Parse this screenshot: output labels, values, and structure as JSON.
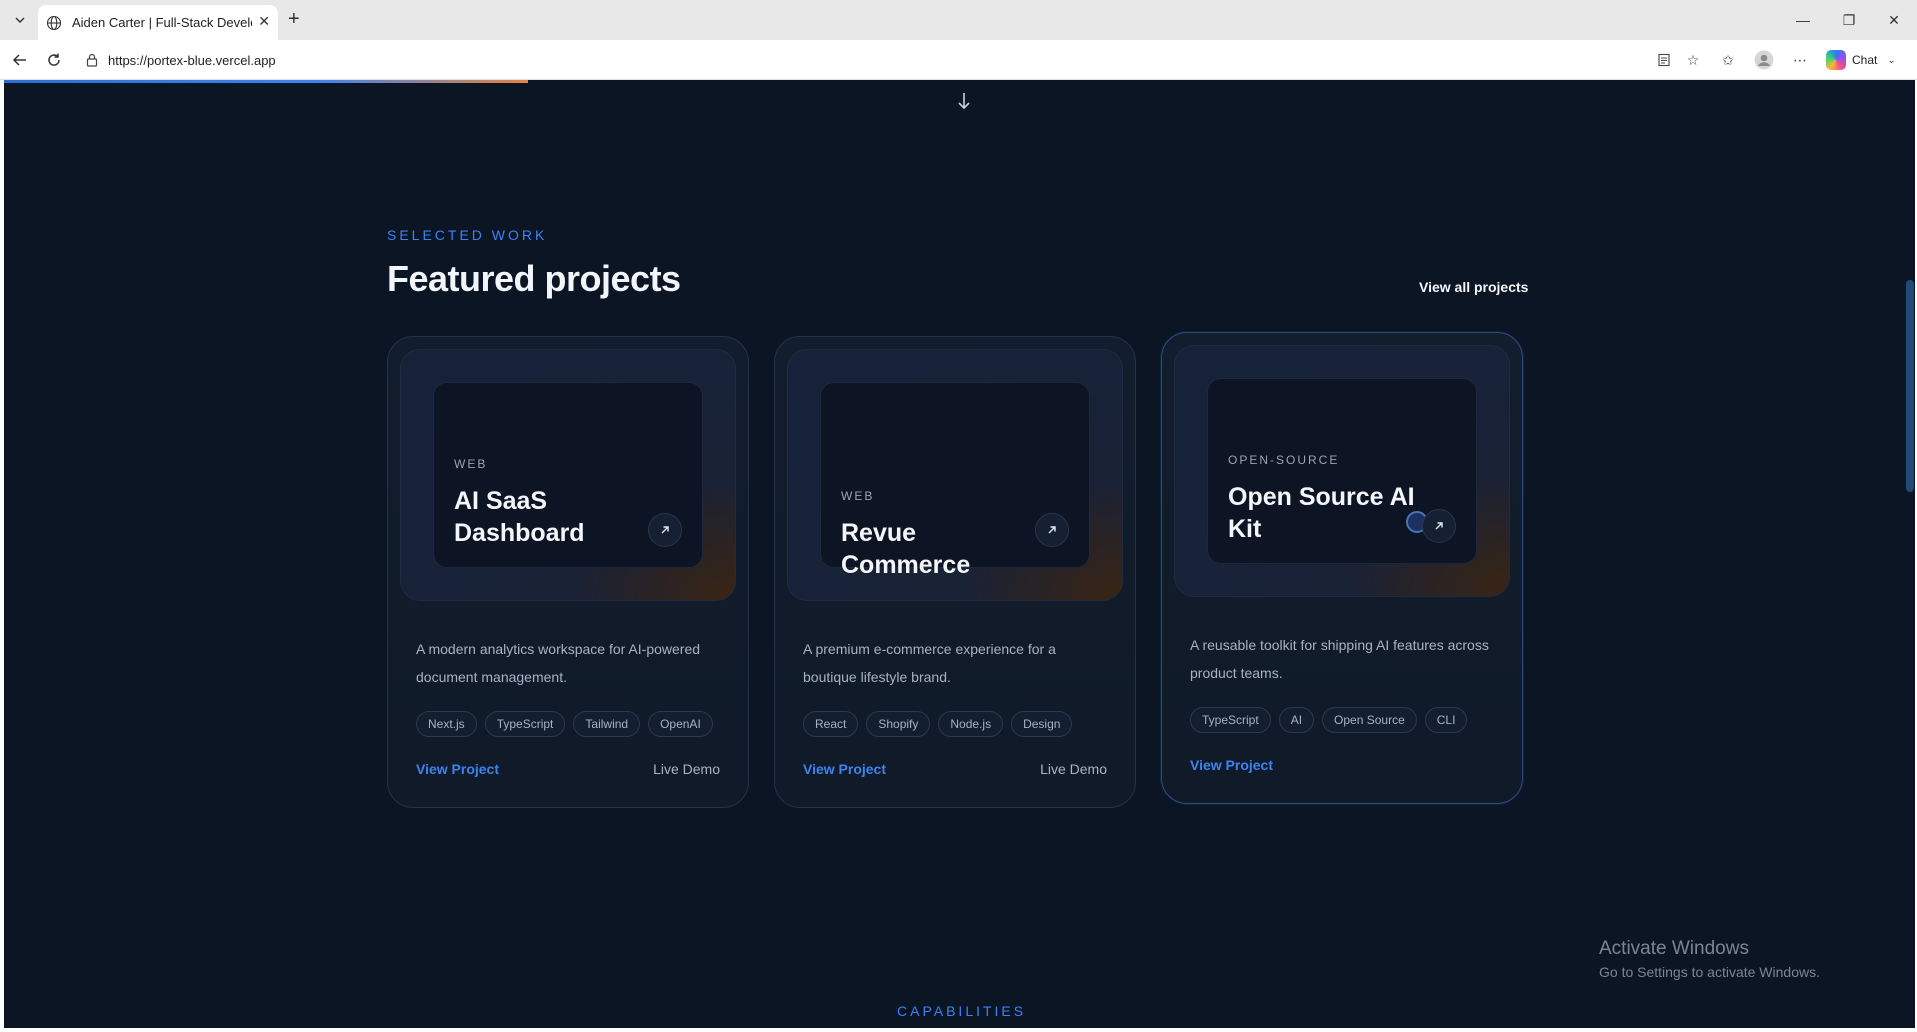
{
  "browser": {
    "tab_title": "Aiden Carter | Full-Stack Developer",
    "url": "https://portex-blue.vercel.app",
    "chat_label": "Chat"
  },
  "section": {
    "eyebrow": "SELECTED WORK",
    "title": "Featured projects",
    "view_all": "View all projects"
  },
  "projects": [
    {
      "category": "WEB",
      "title": "AI SaaS Dashboard",
      "description": "A modern analytics workspace for AI-powered document management.",
      "tags": [
        "Next.js",
        "TypeScript",
        "Tailwind",
        "OpenAI"
      ],
      "view_label": "View Project",
      "demo_label": "Live Demo"
    },
    {
      "category": "WEB",
      "title": "Revue Commerce",
      "description": "A premium e-commerce experience for a boutique lifestyle brand.",
      "tags": [
        "React",
        "Shopify",
        "Node.js",
        "Design"
      ],
      "view_label": "View Project",
      "demo_label": "Live Demo"
    },
    {
      "category": "OPEN-SOURCE",
      "title": "Open Source AI Kit",
      "description": "A reusable toolkit for shipping AI features across product teams.",
      "tags": [
        "TypeScript",
        "AI",
        "Open Source",
        "CLI"
      ],
      "view_label": "View Project"
    }
  ],
  "next_section": {
    "eyebrow": "CAPABILITIES"
  },
  "os_watermark": {
    "title": "Activate Windows",
    "subtitle": "Go to Settings to activate Windows."
  },
  "icons": {
    "tab_list": "chevron-down-icon",
    "globe": "globe-icon",
    "close": "close-icon",
    "new_tab": "plus-icon",
    "back": "arrow-left-icon",
    "refresh": "refresh-icon",
    "site_info": "lock-icon",
    "reader": "reader-icon",
    "favorite": "star-icon",
    "favorites_list": "favorites-icon",
    "profile": "profile-icon",
    "more": "more-icon",
    "scroll_down": "arrow-down-icon",
    "card_link": "arrow-up-right-icon"
  },
  "colors": {
    "page_bg": "#0b1524",
    "accent": "#3b82f6",
    "progress_end": "#e8833a"
  }
}
